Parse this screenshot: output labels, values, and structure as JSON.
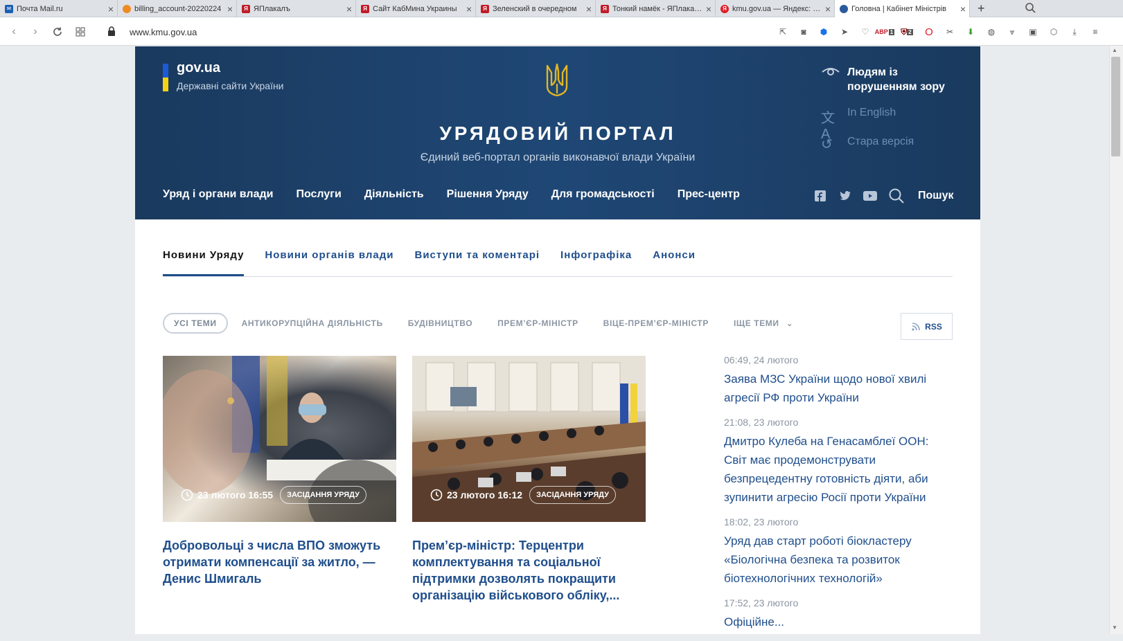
{
  "browser": {
    "tabs": [
      {
        "title": "Почта Mail.ru",
        "icon": "mail-icon",
        "color": "#1a5fb4"
      },
      {
        "title": "billing_account-20220224",
        "icon": "cloud-icon",
        "color": "#f08a24"
      },
      {
        "title": "ЯПлакалъ",
        "icon": "yaplakal-icon",
        "color": "#c01c28"
      },
      {
        "title": "Сайт КабМина Украины",
        "icon": "yaplakal-icon",
        "color": "#c01c28"
      },
      {
        "title": "Зеленский в очередном",
        "icon": "yaplakal-icon",
        "color": "#c01c28"
      },
      {
        "title": "Тонкий намёк - ЯПлакалъ",
        "icon": "yaplakal-icon",
        "color": "#c01c28"
      },
      {
        "title": "kmu.gov.ua — Яндекс: нашлось",
        "icon": "yandex-icon",
        "color": "#e01b24"
      },
      {
        "title": "Головна | Кабінет Міністрів",
        "icon": "trident-icon",
        "color": "#2a5a9c"
      }
    ],
    "new_tab": "+",
    "url": "www.kmu.gov.ua",
    "extension_badges": {
      "abp": "1",
      "ublock": "2"
    }
  },
  "header": {
    "brand": "gov.ua",
    "brand_sub": "Державні сайти України",
    "title": "Урядовий портал",
    "subtitle": "Єдиний веб-портал органів виконавчої влади України",
    "links": {
      "vision_line1": "Людям із",
      "vision_line2": "порушенням зору",
      "english": "In English",
      "old": "Стара версія"
    },
    "nav": [
      "Уряд і органи влади",
      "Послуги",
      "Діяльність",
      "Рішення Уряду",
      "Для громадськості",
      "Прес-центр"
    ],
    "search_label": "Пошук"
  },
  "news": {
    "tabs": [
      "Новини Уряду",
      "Новини органів влади",
      "Виступи та коментарі",
      "Інфографіка",
      "Анонси"
    ],
    "filters": [
      "УСІ ТЕМИ",
      "АНТИКОРУПЦІЙНА ДІЯЛЬНІСТЬ",
      "БУДІВНИЦТВО",
      "ПРЕМ’ЄР-МІНІСТР",
      "ВІЦЕ-ПРЕМ’ЄР-МІНІСТР",
      "ІЩЕ ТЕМИ"
    ],
    "rss": "RSS",
    "cards": [
      {
        "time": "23 лютого 16:55",
        "tag": "ЗАСІДАННЯ УРЯДУ",
        "title": "Добровольці з числа ВПО зможуть отримати компенсації за житло, — Денис Шмигаль"
      },
      {
        "time": "23 лютого 16:12",
        "tag": "ЗАСІДАННЯ УРЯДУ",
        "title": "Прем’єр-міністр: Терцентри комплектування та соціальної підтримки дозволять покращити організацію військового обліку,..."
      }
    ],
    "side": [
      {
        "time": "06:49, 24 лютого",
        "title": "Заява МЗС України щодо нової хвилі агресії РФ проти України"
      },
      {
        "time": "21:08, 23 лютого",
        "title": "Дмитро Кулеба на Генасамблеї ООН: Світ має продемонструвати безпрецедентну готовність діяти, аби зупинити агресію Росії проти України"
      },
      {
        "time": "18:02, 23 лютого",
        "title": "Уряд дав старт роботі біокластеру «Біологічна безпека та розвиток біотехнологічних технологій»"
      },
      {
        "time": "17:52, 23 лютого",
        "title": "Офіційне..."
      }
    ]
  }
}
